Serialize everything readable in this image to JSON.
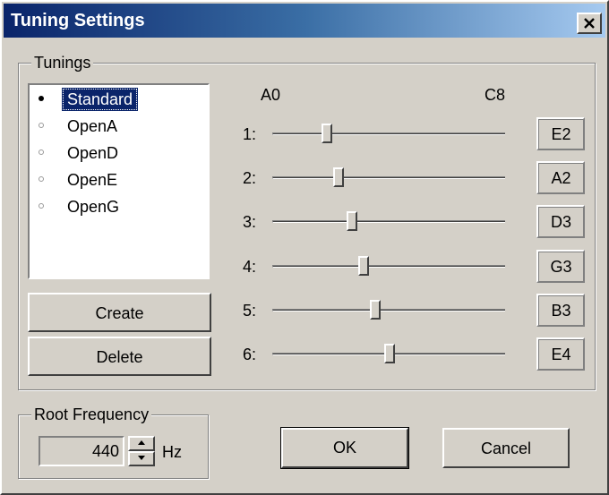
{
  "window": {
    "title": "Tuning Settings"
  },
  "tunings": {
    "group_label": "Tunings",
    "items": [
      {
        "label": "Standard",
        "selected": true
      },
      {
        "label": "OpenA",
        "selected": false
      },
      {
        "label": "OpenD",
        "selected": false
      },
      {
        "label": "OpenE",
        "selected": false
      },
      {
        "label": "OpenG",
        "selected": false
      }
    ],
    "create_label": "Create",
    "delete_label": "Delete"
  },
  "range": {
    "min_label": "A0",
    "max_label": "C8"
  },
  "strings": [
    {
      "label": "1:",
      "note": "E2",
      "level": 0.23
    },
    {
      "label": "2:",
      "note": "A2",
      "level": 0.28
    },
    {
      "label": "3:",
      "note": "D3",
      "level": 0.34
    },
    {
      "label": "4:",
      "note": "G3",
      "level": 0.39
    },
    {
      "label": "5:",
      "note": "B3",
      "level": 0.44
    },
    {
      "label": "6:",
      "note": "E4",
      "level": 0.5
    }
  ],
  "root": {
    "group_label": "Root Frequency",
    "value": "440",
    "unit": "Hz"
  },
  "dialog": {
    "ok_label": "OK",
    "cancel_label": "Cancel"
  },
  "icons": {
    "close": "close-icon",
    "spin_up": "arrow-up-icon",
    "spin_down": "arrow-down-icon",
    "bullet": "bullet-icon"
  },
  "colors": {
    "titlebar_start": "#0a246a",
    "titlebar_end": "#a6caf0",
    "selection": "#0a246a",
    "face": "#d4d0c8"
  }
}
